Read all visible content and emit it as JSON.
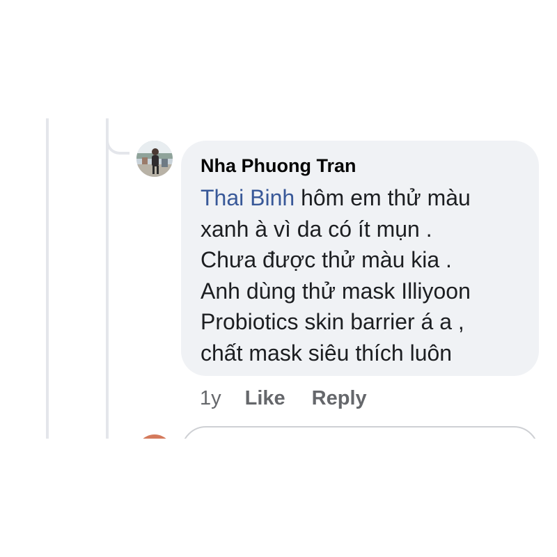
{
  "comment": {
    "author": "Nha Phuong Tran",
    "mention": "Thai Binh",
    "text": " hôm em thử màu\nxanh à vì da có ít mụn .\nChưa được thử màu kia .\nAnh dùng thử mask Illiyoon\nProbiotics skin barrier á a ,\nchất mask siêu thích luôn",
    "timestamp": "1y",
    "like_label": "Like",
    "reply_label": "Reply"
  },
  "colors": {
    "bubble_bg": "#f0f2f5",
    "mention": "#385898",
    "meta_text": "#65676b",
    "thread_line": "#e4e6eb"
  },
  "icons": {
    "avatar": "profile-photo"
  }
}
